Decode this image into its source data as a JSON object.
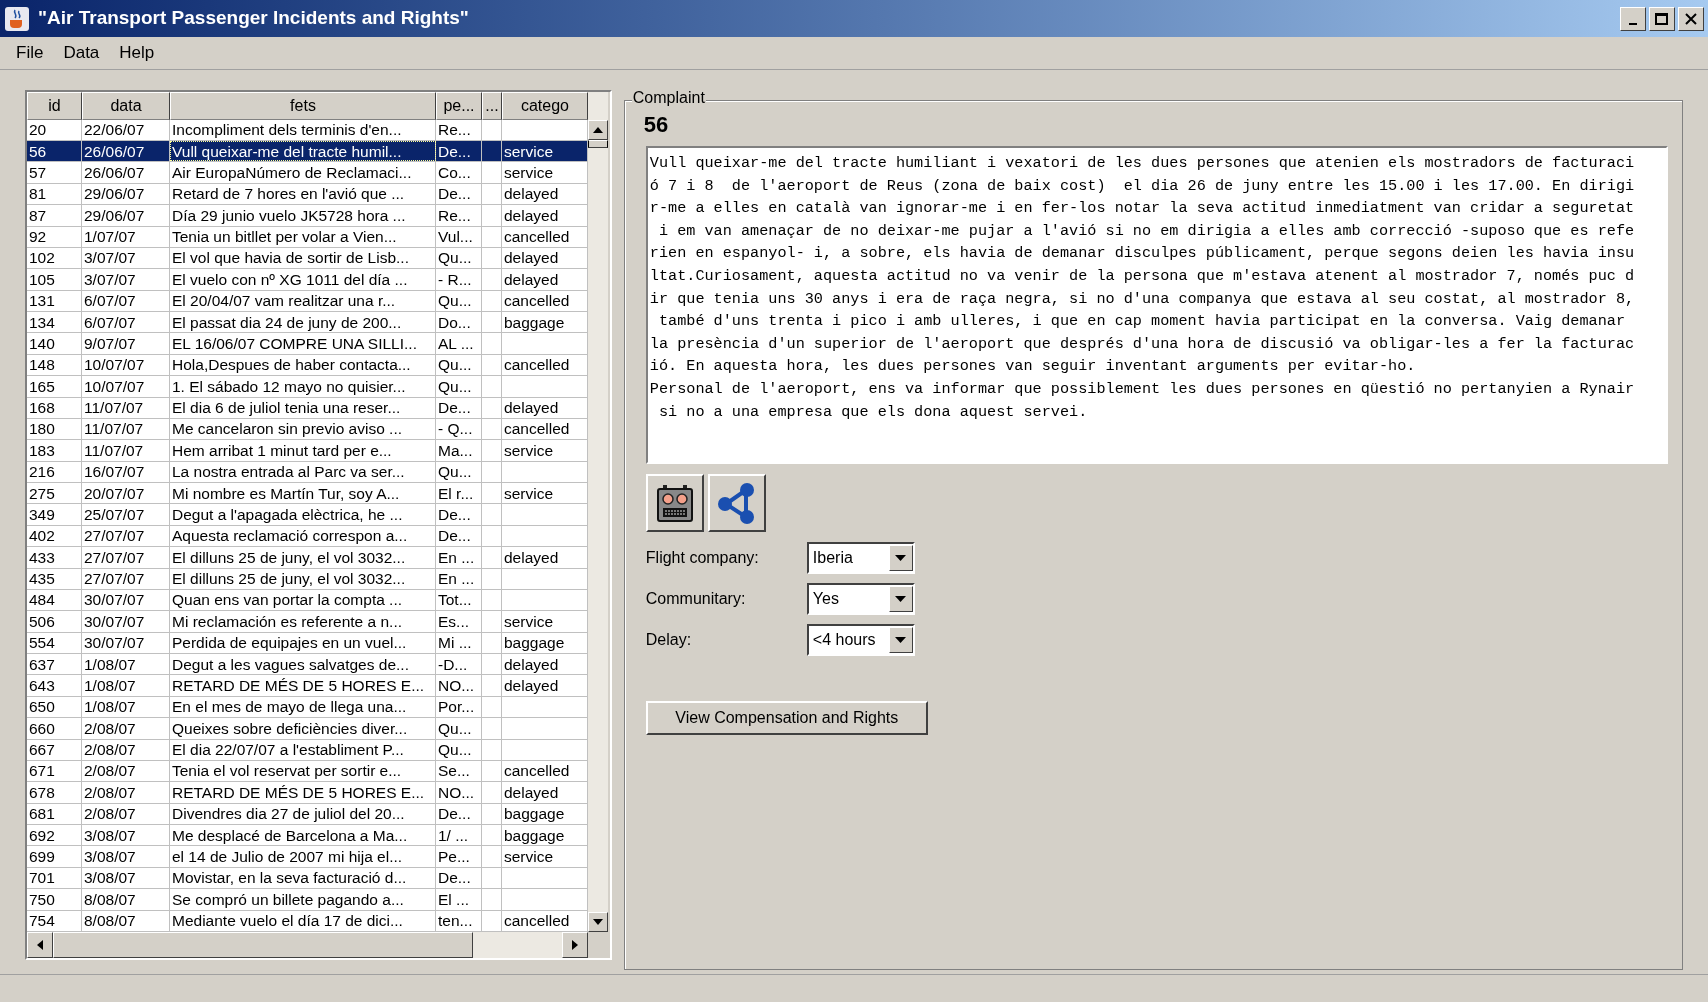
{
  "window": {
    "title": "\"Air Transport Passenger Incidents and Rights\""
  },
  "menu": [
    "File",
    "Data",
    "Help"
  ],
  "table": {
    "columns": [
      "id",
      "data",
      "fets",
      "pe...",
      "...",
      "catego"
    ],
    "rows": [
      {
        "id": "20",
        "data": "22/06/07",
        "fets": "Incompliment dels terminis d'en...",
        "column_4": "Re...",
        "selected": false
      },
      {
        "id": "56",
        "data": "26/06/07",
        "fets": "Vull queixar-me del tracte humil...",
        "column_4": "De...",
        "category": "service",
        "selected": true
      },
      {
        "id": "57",
        "data": "26/06/07",
        "fets": "Air EuropaNúmero de Reclamaci...",
        "column_4": "Co...",
        "category": "service",
        "selected": false
      },
      {
        "id": "81",
        "data": "29/06/07",
        "fets": "Retard de 7 hores en l'avió que ...",
        "column_4": "De...",
        "category": "delayed",
        "selected": false
      },
      {
        "id": "87",
        "data": "29/06/07",
        "fets": "Día 29 junio vuelo JK5728 hora ...",
        "column_4": "Re...",
        "category": "delayed",
        "selected": false
      },
      {
        "id": "92",
        "data": "1/07/07",
        "fets": "Tenia un bitllet per volar a Vien...",
        "column_4": "Vul...",
        "category": "cancelled",
        "selected": false
      },
      {
        "id": "102",
        "data": "3/07/07",
        "fets": "El vol que havia de sortir de Lisb...",
        "column_4": "Qu...",
        "category": "delayed",
        "selected": false
      },
      {
        "id": "105",
        "data": "3/07/07",
        "fets": "El vuelo con nº XG 1011 del día ...",
        "column_4": "- R...",
        "category": "delayed",
        "selected": false
      },
      {
        "id": "131",
        "data": "6/07/07",
        "fets": "El 20/04/07 vam realitzar una r...",
        "column_4": "Qu...",
        "category": "cancelled",
        "selected": false
      },
      {
        "id": "134",
        "data": "6/07/07",
        "fets": "El passat dia 24 de juny de 200...",
        "column_4": "Do...",
        "category": "baggage",
        "selected": false
      },
      {
        "id": "140",
        "data": "9/07/07",
        "fets": "EL 16/06/07 COMPRE UNA SILLI...",
        "column_4": "AL ...",
        "selected": false
      },
      {
        "id": "148",
        "data": "10/07/07",
        "fets": "Hola,Despues de haber contacta...",
        "column_4": "Qu...",
        "category": "cancelled",
        "selected": false
      },
      {
        "id": "165",
        "data": "10/07/07",
        "fets": "1. El sábado 12 mayo no quisier...",
        "column_4": "Qu...",
        "selected": false
      },
      {
        "id": "168",
        "data": "11/07/07",
        "fets": "El dia 6 de juliol tenia una reser...",
        "column_4": "De...",
        "category": "delayed",
        "selected": false
      },
      {
        "id": "180",
        "data": "11/07/07",
        "fets": "Me cancelaron sin previo aviso ...",
        "column_4": "- Q...",
        "category": "cancelled",
        "selected": false
      },
      {
        "id": "183",
        "data": "11/07/07",
        "fets": "Hem arribat 1 minut tard per e...",
        "column_4": "Ma...",
        "category": "service",
        "selected": false
      },
      {
        "id": "216",
        "data": "16/07/07",
        "fets": "La nostra entrada al Parc va ser...",
        "column_4": "Qu...",
        "selected": false
      },
      {
        "id": "275",
        "data": "20/07/07",
        "fets": "Mi nombre es Martín Tur, soy A...",
        "column_4": "El r...",
        "category": "service",
        "selected": false
      },
      {
        "id": "349",
        "data": "25/07/07",
        "fets": "Degut a l'apagada elèctrica, he ...",
        "column_4": "De...",
        "selected": false
      },
      {
        "id": "402",
        "data": "27/07/07",
        "fets": "Aquesta reclamació correspon a...",
        "column_4": "De...",
        "selected": false
      },
      {
        "id": "433",
        "data": "27/07/07",
        "fets": "El dilluns 25 de juny, el vol 3032...",
        "column_4": "En ...",
        "category": "delayed",
        "selected": false
      },
      {
        "id": "435",
        "data": "27/07/07",
        "fets": "El dilluns 25 de juny, el vol 3032...",
        "column_4": "En ...",
        "selected": false
      },
      {
        "id": "484",
        "data": "30/07/07",
        "fets": "Quan ens van portar la compta ...",
        "column_4": "Tot...",
        "selected": false
      },
      {
        "id": "506",
        "data": "30/07/07",
        "fets": "Mi reclamación es referente a n...",
        "column_4": "Es...",
        "category": "service",
        "selected": false
      },
      {
        "id": "554",
        "data": "30/07/07",
        "fets": "Perdida de equipajes en un vuel...",
        "column_4": "Mi ...",
        "category": "baggage",
        "selected": false
      },
      {
        "id": "637",
        "data": "1/08/07",
        "fets": "Degut a les vagues salvatges de...",
        "column_4": "-D...",
        "category": "delayed",
        "selected": false
      },
      {
        "id": "643",
        "data": "1/08/07",
        "fets": "RETARD DE MÉS DE 5 HORES E...",
        "column_4": "NO...",
        "category": "delayed",
        "selected": false
      },
      {
        "id": "650",
        "data": "1/08/07",
        "fets": "En el mes de mayo de llega una...",
        "column_4": "Por...",
        "selected": false
      },
      {
        "id": "660",
        "data": "2/08/07",
        "fets": "Queixes sobre deficiències diver...",
        "column_4": "Qu...",
        "selected": false
      },
      {
        "id": "667",
        "data": "2/08/07",
        "fets": "El dia 22/07/07 a l'establiment P...",
        "column_4": "Qu...",
        "selected": false
      },
      {
        "id": "671",
        "data": "2/08/07",
        "fets": "Tenia el vol reservat per sortir e...",
        "column_4": "Se...",
        "category": "cancelled",
        "selected": false
      },
      {
        "id": "678",
        "data": "2/08/07",
        "fets": "RETARD DE MÉS DE 5 HORES E...",
        "column_4": "NO...",
        "category": "delayed",
        "selected": false
      },
      {
        "id": "681",
        "data": "2/08/07",
        "fets": "Divendres dia 27 de juliol del 20...",
        "column_4": "De...",
        "category": "baggage",
        "selected": false
      },
      {
        "id": "692",
        "data": "3/08/07",
        "fets": "Me desplacé de Barcelona a Ma...",
        "column_4": "1/ ...",
        "category": "baggage",
        "selected": false
      },
      {
        "id": "699",
        "data": "3/08/07",
        "fets": "el 14 de Julio de 2007 mi hija el...",
        "column_4": "Pe...",
        "category": "service",
        "selected": false
      },
      {
        "id": "701",
        "data": "3/08/07",
        "fets": "Movistar, en la seva facturació d...",
        "column_4": "De...",
        "selected": false
      },
      {
        "id": "750",
        "data": "8/08/07",
        "fets": "Se compró un billete pagando a...",
        "column_4": "El ...",
        "selected": false
      },
      {
        "id": "754",
        "data": "8/08/07",
        "fets": "Mediante vuelo el día 17 de dici...",
        "column_4": "ten...",
        "category": "cancelled",
        "selected": false
      }
    ]
  },
  "complaint": {
    "title": "Complaint",
    "number": "56",
    "text": [
      "Vull queixar-me del tracte humiliant i vexatori de les dues persones que atenien els mostradors de facturaci",
      "ó 7 i 8  de l'aeroport de Reus (zona de baix cost)  el dia 26 de juny entre les 15.00 i les 17.00. En dirigi",
      "r-me a elles en català van ignorar-me i en fer-los notar la seva actitud inmediatment van cridar a seguretat",
      " i em van amenaçar de no deixar-me pujar a l'avió si no em dirigia a elles amb correcció -suposo que es refe",
      "rien en espanyol- i, a sobre, els havia de demanar disculpes públicament, perque segons deien les havia insu",
      "ltat.Curiosament, aquesta actitud no va venir de la persona que m'estava atenent al mostrador 7, només puc d",
      "ir que tenia uns 30 anys i era de raça negra, si no d'una companya que estava al seu costat, al mostrador 8,",
      " també d'uns trenta i pico i amb ulleres, i que en cap moment havia participat en la conversa. Vaig demanar",
      "la presència d'un superior de l'aeroport que després d'una hora de discusió va obligar-les a fer la facturac",
      "ió. En aquesta hora, les dues persones van seguir inventant arguments per evitar-ho.",
      "Personal de l'aeroport, ens va informar que possiblement les dues persones en qüestió no pertanyien a Rynair",
      " si no a una empresa que els dona aquest servei."
    ],
    "fields": [
      {
        "label": "Flight company:",
        "value": "Iberia"
      },
      {
        "label": "Communitary:",
        "value": "Yes"
      },
      {
        "label": "Delay:",
        "value": "<4 hours"
      }
    ],
    "button": "View Compensation and Rights"
  }
}
